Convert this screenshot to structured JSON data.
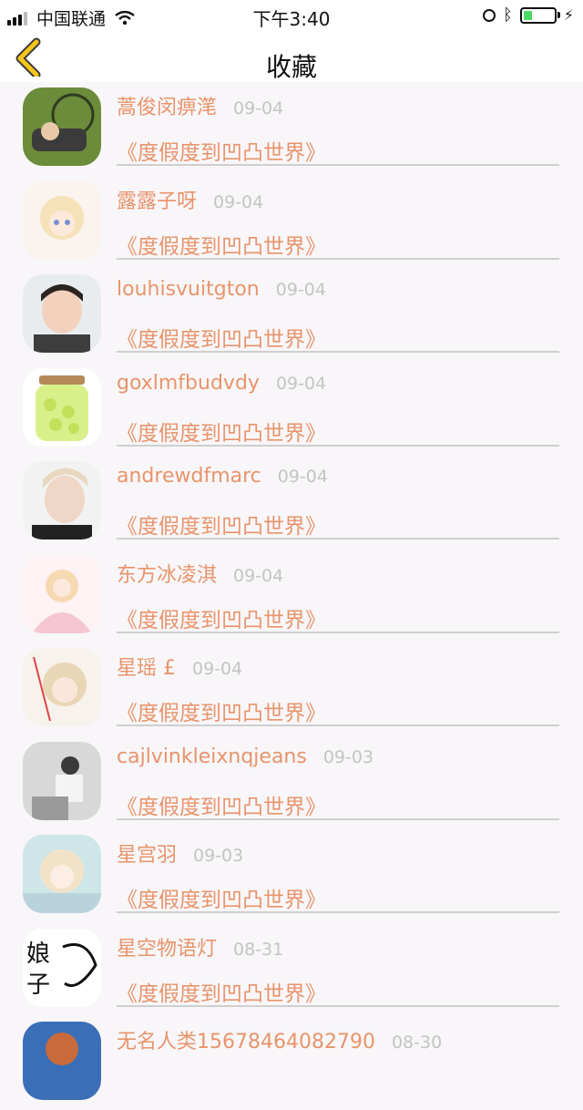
{
  "status_bar": {
    "carrier": "中国联通",
    "time": "下午3:40",
    "battery_level": 0.3
  },
  "nav": {
    "title": "收藏",
    "back_icon": "chevron-left-icon",
    "accent": "#f5c518"
  },
  "colors": {
    "name": "#e8946c",
    "date": "#c4c4c4",
    "background": "#f8f6f8"
  },
  "favorites": [
    {
      "name": "蒿俊闵痹滗",
      "date": "09-04",
      "book": "《度假度到凹凸世界》",
      "avatar": "user-avatar"
    },
    {
      "name": "露露子呀",
      "date": "09-04",
      "book": "《度假度到凹凸世界》",
      "avatar": "user-avatar"
    },
    {
      "name": "louhisvuitgton",
      "date": "09-04",
      "book": "《度假度到凹凸世界》",
      "avatar": "user-avatar"
    },
    {
      "name": "goxlmfbudvdy",
      "date": "09-04",
      "book": "《度假度到凹凸世界》",
      "avatar": "user-avatar"
    },
    {
      "name": "andrewdfmarc",
      "date": "09-04",
      "book": "《度假度到凹凸世界》",
      "avatar": "user-avatar"
    },
    {
      "name": "东方冰凌淇",
      "date": "09-04",
      "book": "《度假度到凹凸世界》",
      "avatar": "user-avatar"
    },
    {
      "name": "星瑶 £",
      "date": "09-04",
      "book": "《度假度到凹凸世界》",
      "avatar": "user-avatar"
    },
    {
      "name": "cajlvinkleixnqjeans",
      "date": "09-03",
      "book": "《度假度到凹凸世界》",
      "avatar": "user-avatar"
    },
    {
      "name": "星宫羽",
      "date": "09-03",
      "book": "《度假度到凹凸世界》",
      "avatar": "user-avatar"
    },
    {
      "name": "星空物语灯",
      "date": "08-31",
      "book": "《度假度到凹凸世界》",
      "avatar": "user-avatar"
    },
    {
      "name": "无名人类15678464082790",
      "date": "08-30",
      "book": "",
      "avatar": "user-avatar"
    }
  ]
}
